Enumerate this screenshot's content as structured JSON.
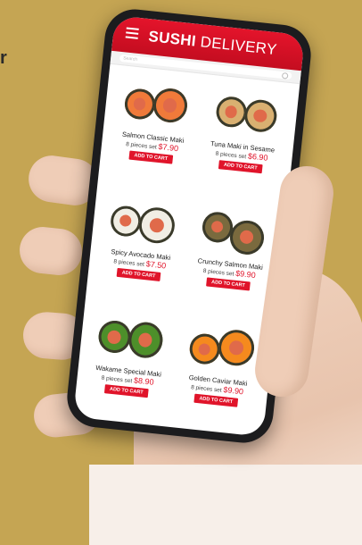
{
  "page_fragment": "r",
  "app": {
    "title_bold": "SUSHI",
    "title_light": "DELIVERY",
    "search_placeholder": "Search",
    "accent_color": "#e0142a"
  },
  "items": [
    {
      "name": "Salmon Classic Maki",
      "pieces": "8 pieces set",
      "price": "$7.90",
      "button": "ADD TO CART",
      "roll_color": "#f07a3a"
    },
    {
      "name": "Tuna Maki in Sesame",
      "pieces": "8 pieces set",
      "price": "$6.90",
      "button": "ADD TO CART",
      "roll_color": "#d9b071"
    },
    {
      "name": "Spicy Avocado Maki",
      "pieces": "8 pieces set",
      "price": "$7.50",
      "button": "ADD TO CART",
      "roll_color": "#f1eee4"
    },
    {
      "name": "Crunchy Salmon Maki",
      "pieces": "8 pieces set",
      "price": "$9.90",
      "button": "ADD TO CART",
      "roll_color": "#7a6a3e"
    },
    {
      "name": "Wakame Special Maki",
      "pieces": "8 pieces set",
      "price": "$8.90",
      "button": "ADD TO CART",
      "roll_color": "#4d8f2a"
    },
    {
      "name": "Golden Caviar Maki",
      "pieces": "8 pieces set",
      "price": "$9.90",
      "button": "ADD TO CART",
      "roll_color": "#f58a1e"
    }
  ]
}
